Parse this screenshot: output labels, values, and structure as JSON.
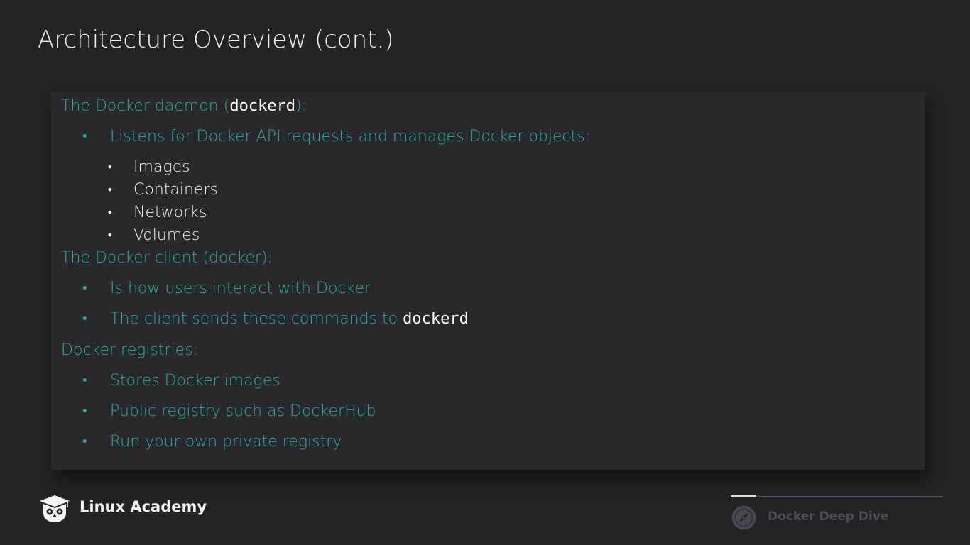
{
  "slide": {
    "title": "Architecture Overview (cont.)"
  },
  "content": {
    "daemon_heading_pre": "The Docker daemon (",
    "daemon_heading_code": "dockerd",
    "daemon_heading_post": "):",
    "daemon_bullet_1": "Listens for Docker API requests and manages Docker objects:",
    "docker_objects": [
      "Images",
      "Containers",
      "Networks",
      "Volumes"
    ],
    "client_heading": "The Docker client (docker):",
    "client_bullet_1": "Is how users interact with Docker",
    "client_bullet_2_pre": "The client sends these commands to ",
    "client_bullet_2_code": "dockerd",
    "registries_heading": "Docker registries:",
    "registries_bullet_1": "Stores Docker images",
    "registries_bullet_2": "Public registry such as DockerHub",
    "registries_bullet_3": "Run your own private registry",
    "bullet_glyph": "•"
  },
  "footer": {
    "brand": "Linux Academy",
    "brand_icon": "owl-graduation-cap-icon",
    "course": "Docker Deep Dive",
    "course_icon": "compass-icon",
    "progress_fraction": 0.12
  },
  "colors": {
    "background": "#232326",
    "panel": "#29292b",
    "accent_teal": "#2cae93",
    "text_white": "#f3f3f3"
  }
}
